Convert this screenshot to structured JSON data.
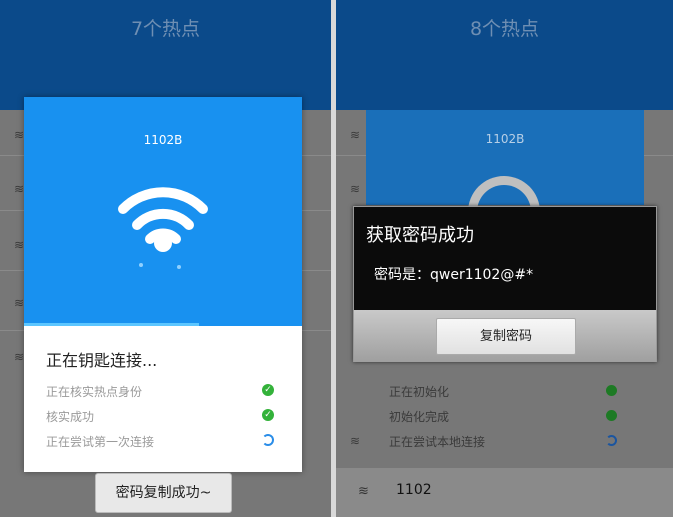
{
  "left": {
    "title": "7个热点",
    "dialog": {
      "ssid": "1102B",
      "heading": "正在钥匙连接...",
      "steps": [
        "正在核实热点身份",
        "核实成功",
        "正在尝试第一次连接"
      ],
      "step_status": [
        "done",
        "done",
        "loading"
      ],
      "progress": 0.63
    },
    "toast": "密码复制成功~"
  },
  "right": {
    "title": "8个热点",
    "bg_ssid": "1102B",
    "password_dialog": {
      "title": "获取密码成功",
      "message": "密码是：qwer1102@#*",
      "copy_button": "复制密码"
    },
    "steps": [
      "正在初始化",
      "初始化完成",
      "正在尝试本地连接"
    ],
    "step_status": [
      "done",
      "done",
      "loading"
    ],
    "bottom_item": "1102"
  },
  "colors": {
    "primary_blue": "#1891f0",
    "topbar": "#0b4a8a",
    "success_green": "#33b23a"
  }
}
